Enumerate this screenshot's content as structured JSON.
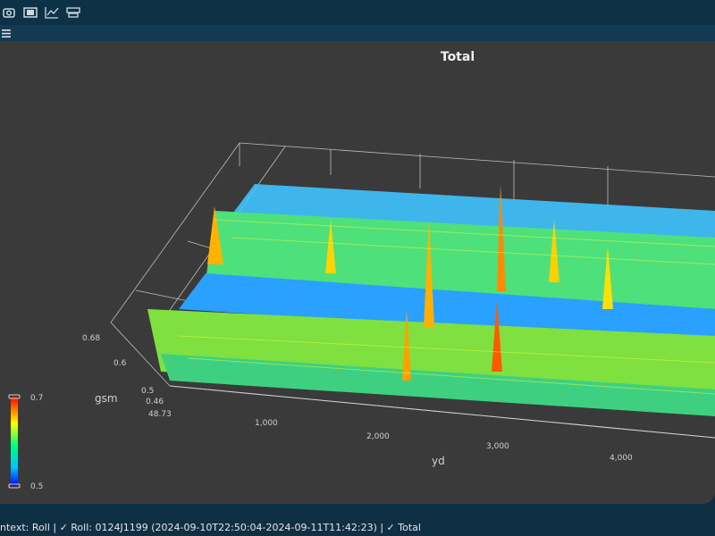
{
  "toolbar": {
    "icons": [
      "camera-icon",
      "film-icon",
      "line-chart-icon",
      "ruler-icon"
    ]
  },
  "chart": {
    "title": "Total",
    "x_label": "yd",
    "y_label": "gsm",
    "x_ticks": [
      "1,000",
      "2,000",
      "3,000",
      "4,000"
    ],
    "y_ticks": [
      "0.68",
      "0.6",
      "0.5",
      "0.46"
    ],
    "y_min_label": "48.73",
    "colorbar": {
      "max": "0.7",
      "min": "0.5"
    }
  },
  "chart_data": {
    "type": "heatmap",
    "title": "Total",
    "xlabel": "yd",
    "ylabel": "gsm",
    "x_ticks": [
      1000,
      2000,
      3000,
      4000
    ],
    "y_ticks": [
      0.68,
      0.6,
      0.5,
      0.46
    ],
    "colorbar_range": [
      0.5,
      0.7
    ],
    "colors": [
      "#0000ff",
      "#00bfff",
      "#00ff80",
      "#ffff00",
      "#ff8000",
      "#ff0000"
    ]
  },
  "status_bar": {
    "text": "ntext: Roll | ✓ Roll: 0124J1199 (2024-09-10T22:50:04-2024-09-11T11:42:23) | ✓ Total"
  }
}
